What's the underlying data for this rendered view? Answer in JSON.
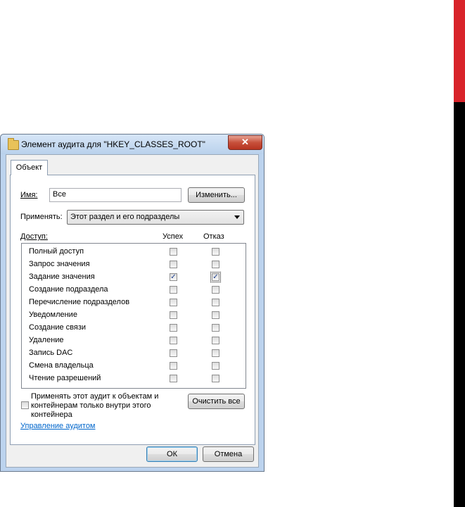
{
  "dialog": {
    "title": "Элемент аудита для \"HKEY_CLASSES_ROOT\"",
    "close_glyph": "✕"
  },
  "tab": {
    "label": "Объект"
  },
  "name_field": {
    "label": "Имя:",
    "value": "Все",
    "change_button": "Изменить..."
  },
  "apply": {
    "label": "Применять:",
    "value": "Этот раздел и его подразделы"
  },
  "access": {
    "label": "Доступ:",
    "col_success": "Успех",
    "col_failure": "Отказ",
    "rows": [
      {
        "name": "Полный доступ",
        "success": false,
        "failure": false
      },
      {
        "name": "Запрос значения",
        "success": false,
        "failure": false
      },
      {
        "name": "Задание значения",
        "success": true,
        "failure": true
      },
      {
        "name": "Создание подраздела",
        "success": false,
        "failure": false
      },
      {
        "name": "Перечисление подразделов",
        "success": false,
        "failure": false
      },
      {
        "name": "Уведомление",
        "success": false,
        "failure": false
      },
      {
        "name": "Создание связи",
        "success": false,
        "failure": false
      },
      {
        "name": "Удаление",
        "success": false,
        "failure": false
      },
      {
        "name": "Запись DAC",
        "success": false,
        "failure": false
      },
      {
        "name": "Смена владельца",
        "success": false,
        "failure": false
      },
      {
        "name": "Чтение разрешений",
        "success": false,
        "failure": false
      }
    ]
  },
  "inherit": {
    "line1": "Применять этот аудит к объектам и",
    "line2": "контейнерам только внутри этого",
    "line3": "контейнера",
    "checked": false
  },
  "clear_all_button": "Очистить все",
  "manage_link": "Управление аудитом",
  "ok_button": "ОК",
  "cancel_button": "Отмена",
  "colors": {
    "accent_red": "#d8232a",
    "link": "#0066cc",
    "check": "#1c3f8f"
  }
}
